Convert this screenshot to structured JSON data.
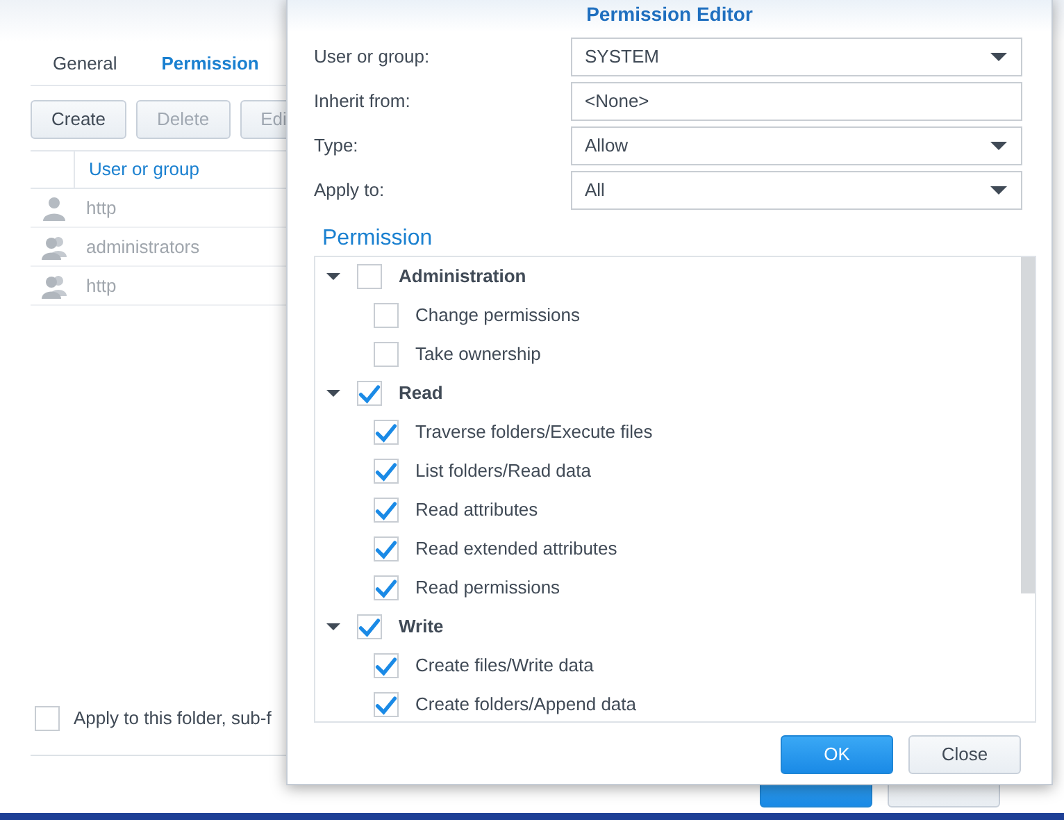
{
  "main_window": {
    "tabs": [
      {
        "label": "General",
        "selected": false
      },
      {
        "label": "Permission",
        "selected": true
      }
    ],
    "toolbar": [
      {
        "label": "Create",
        "disabled": false
      },
      {
        "label": "Delete",
        "disabled": true
      },
      {
        "label": "Edi",
        "disabled": true
      }
    ],
    "table": {
      "columns": [
        "User or group"
      ],
      "rows": [
        {
          "kind": "user",
          "name": "http"
        },
        {
          "kind": "group",
          "name": "administrators"
        },
        {
          "kind": "group",
          "name": "http"
        }
      ]
    },
    "apply_option": {
      "label": "Apply to this folder, sub-f",
      "checked": false
    },
    "buttons": [
      {
        "primary": true
      },
      {
        "primary": false
      }
    ]
  },
  "dialog": {
    "title": "Permission Editor",
    "fields": [
      {
        "label": "User or group:",
        "value": "SYSTEM",
        "kind": "select"
      },
      {
        "label": "Inherit from:",
        "value": "<None>",
        "kind": "text"
      },
      {
        "label": "Type:",
        "value": "Allow",
        "kind": "select"
      },
      {
        "label": "Apply to:",
        "value": "All",
        "kind": "select"
      }
    ],
    "section": "Permission",
    "tree": [
      {
        "label": "Administration",
        "checked": false,
        "expanded": true,
        "children": [
          {
            "label": "Change permissions",
            "checked": false
          },
          {
            "label": "Take ownership",
            "checked": false
          }
        ]
      },
      {
        "label": "Read",
        "checked": true,
        "expanded": true,
        "children": [
          {
            "label": "Traverse folders/Execute files",
            "checked": true
          },
          {
            "label": "List folders/Read data",
            "checked": true
          },
          {
            "label": "Read attributes",
            "checked": true
          },
          {
            "label": "Read extended attributes",
            "checked": true
          },
          {
            "label": "Read permissions",
            "checked": true
          }
        ]
      },
      {
        "label": "Write",
        "checked": true,
        "expanded": true,
        "children": [
          {
            "label": "Create files/Write data",
            "checked": true
          },
          {
            "label": "Create folders/Append data",
            "checked": true
          }
        ]
      }
    ],
    "buttons": [
      {
        "label": "OK",
        "primary": true
      },
      {
        "label": "Close",
        "primary": false
      }
    ]
  }
}
